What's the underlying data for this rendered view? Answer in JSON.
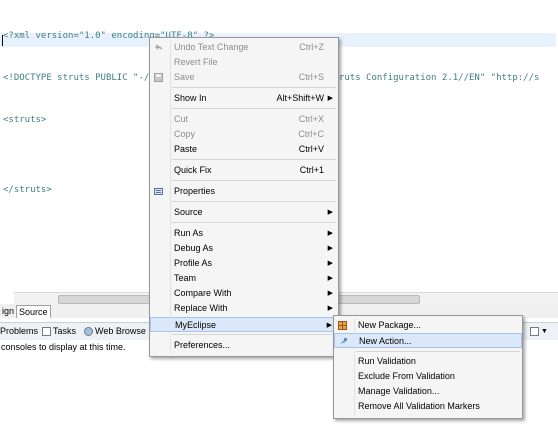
{
  "editor": {
    "lines": [
      "<?xml version=\"1.0\" encoding=\"UTF-8\" ?>",
      "<!DOCTYPE struts PUBLIC \"-//Apache Software Foundation//DTD Struts Configuration 2.1//EN\" \"http://s",
      "<struts>",
      "",
      "</struts>"
    ]
  },
  "editor_tabs": {
    "design": "ign",
    "source": "Source"
  },
  "views": {
    "problems": "Problems",
    "tasks": "Tasks",
    "web_browser": "Web Browse",
    "console_message": "consoles to display at this time."
  },
  "context_menu": {
    "items": [
      {
        "label": "Undo Text Change",
        "accel": "Ctrl+Z"
      },
      {
        "label": "Revert File",
        "accel": ""
      },
      {
        "label": "Save",
        "accel": "Ctrl+S"
      },
      {
        "label": "Show In",
        "accel": "Alt+Shift+W"
      },
      {
        "label": "Cut",
        "accel": "Ctrl+X"
      },
      {
        "label": "Copy",
        "accel": "Ctrl+C"
      },
      {
        "label": "Paste",
        "accel": "Ctrl+V"
      },
      {
        "label": "Quick Fix",
        "accel": "Ctrl+1"
      },
      {
        "label": "Properties",
        "accel": ""
      },
      {
        "label": "Source",
        "accel": ""
      },
      {
        "label": "Run As",
        "accel": ""
      },
      {
        "label": "Debug As",
        "accel": ""
      },
      {
        "label": "Profile As",
        "accel": ""
      },
      {
        "label": "Team",
        "accel": ""
      },
      {
        "label": "Compare With",
        "accel": ""
      },
      {
        "label": "Replace With",
        "accel": ""
      },
      {
        "label": "MyEclipse",
        "accel": ""
      },
      {
        "label": "Preferences...",
        "accel": ""
      }
    ]
  },
  "submenu": {
    "items": [
      {
        "label": "New Package..."
      },
      {
        "label": "New Action..."
      },
      {
        "label": "Run Validation"
      },
      {
        "label": "Exclude From Validation"
      },
      {
        "label": "Manage Validation..."
      },
      {
        "label": "Remove All Validation Markers"
      }
    ]
  }
}
